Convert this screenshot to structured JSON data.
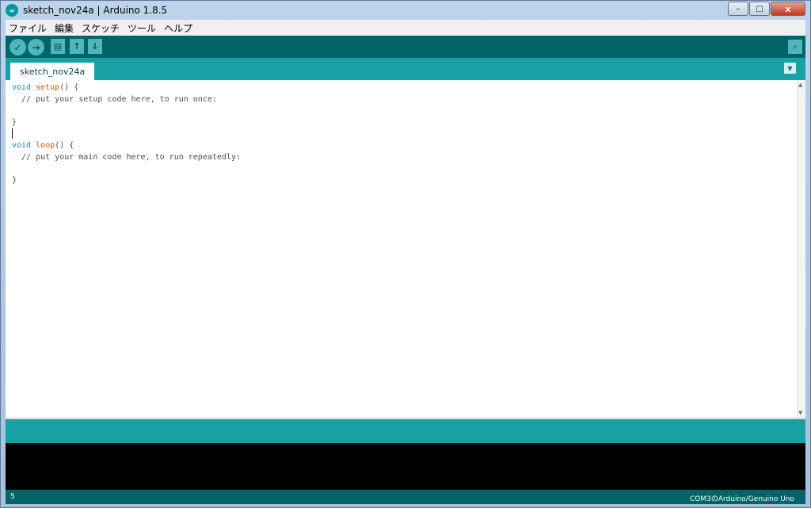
{
  "window": {
    "title": "sketch_nov24a | Arduino 1.8.5",
    "controls": {
      "minimize": "–",
      "maximize": "□",
      "close": "x"
    }
  },
  "menubar": {
    "items": [
      "ファイル",
      "編集",
      "スケッチ",
      "ツール",
      "ヘルプ"
    ]
  },
  "toolbar": {
    "buttons": [
      "verify-icon",
      "upload-icon",
      "new-icon",
      "open-icon",
      "save-icon"
    ],
    "serial_monitor": "serial-monitor-icon"
  },
  "tabs": [
    {
      "label": "sketch_nov24a",
      "active": true
    }
  ],
  "editor": {
    "lines": [
      "void setup() {",
      "  // put your setup code here, to run once:",
      "",
      "}",
      "",
      "void loop() {",
      "  // put your main code here, to run repeatedly:",
      "",
      "}"
    ]
  },
  "status": {
    "line_number": "5",
    "board": "COM3のArduino/Genuino Uno"
  },
  "colors": {
    "toolbar": "#006468",
    "tabbar": "#17a1a5",
    "keyword": "#00979c",
    "function": "#d35400"
  }
}
